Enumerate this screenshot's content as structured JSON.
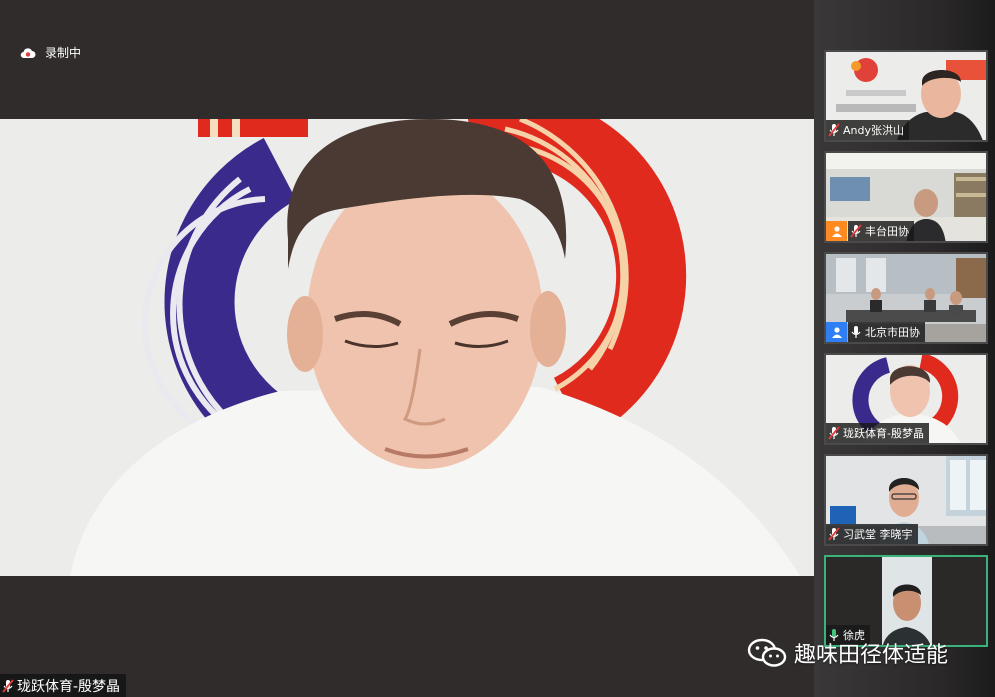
{
  "recording": {
    "label": "录制中"
  },
  "main_speaker": {
    "name": "珑跃体育-殷梦晶"
  },
  "participants": [
    {
      "name": "Andy张洪山",
      "mic": "muted",
      "role": ""
    },
    {
      "name": "丰台田协",
      "mic": "muted",
      "role": "orange"
    },
    {
      "name": "北京市田协",
      "mic": "on",
      "role": "blue"
    },
    {
      "name": "珑跃体育-殷梦晶",
      "mic": "muted",
      "role": ""
    },
    {
      "name": "习武堂 李晓宇",
      "mic": "muted",
      "role": ""
    },
    {
      "name": "徐虎",
      "mic": "active",
      "role": ""
    }
  ],
  "watermark": {
    "text": "趣味田径体适能"
  },
  "colors": {
    "speaking_border": "#3bb27a",
    "role_orange": "#ff8a1f",
    "role_blue": "#2f7ef5",
    "mic_muted": "#e23b3b",
    "mic_active": "#44c27a"
  }
}
